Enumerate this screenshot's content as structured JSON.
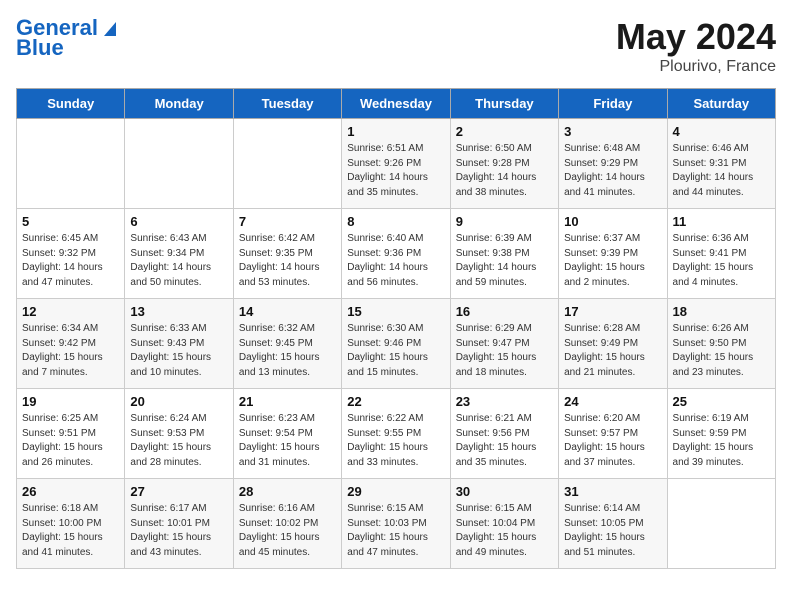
{
  "logo": {
    "line1": "General",
    "line2": "Blue"
  },
  "title": "May 2024",
  "location": "Plourivo, France",
  "days_header": [
    "Sunday",
    "Monday",
    "Tuesday",
    "Wednesday",
    "Thursday",
    "Friday",
    "Saturday"
  ],
  "weeks": [
    [
      {
        "num": "",
        "info": ""
      },
      {
        "num": "",
        "info": ""
      },
      {
        "num": "",
        "info": ""
      },
      {
        "num": "1",
        "info": "Sunrise: 6:51 AM\nSunset: 9:26 PM\nDaylight: 14 hours\nand 35 minutes."
      },
      {
        "num": "2",
        "info": "Sunrise: 6:50 AM\nSunset: 9:28 PM\nDaylight: 14 hours\nand 38 minutes."
      },
      {
        "num": "3",
        "info": "Sunrise: 6:48 AM\nSunset: 9:29 PM\nDaylight: 14 hours\nand 41 minutes."
      },
      {
        "num": "4",
        "info": "Sunrise: 6:46 AM\nSunset: 9:31 PM\nDaylight: 14 hours\nand 44 minutes."
      }
    ],
    [
      {
        "num": "5",
        "info": "Sunrise: 6:45 AM\nSunset: 9:32 PM\nDaylight: 14 hours\nand 47 minutes."
      },
      {
        "num": "6",
        "info": "Sunrise: 6:43 AM\nSunset: 9:34 PM\nDaylight: 14 hours\nand 50 minutes."
      },
      {
        "num": "7",
        "info": "Sunrise: 6:42 AM\nSunset: 9:35 PM\nDaylight: 14 hours\nand 53 minutes."
      },
      {
        "num": "8",
        "info": "Sunrise: 6:40 AM\nSunset: 9:36 PM\nDaylight: 14 hours\nand 56 minutes."
      },
      {
        "num": "9",
        "info": "Sunrise: 6:39 AM\nSunset: 9:38 PM\nDaylight: 14 hours\nand 59 minutes."
      },
      {
        "num": "10",
        "info": "Sunrise: 6:37 AM\nSunset: 9:39 PM\nDaylight: 15 hours\nand 2 minutes."
      },
      {
        "num": "11",
        "info": "Sunrise: 6:36 AM\nSunset: 9:41 PM\nDaylight: 15 hours\nand 4 minutes."
      }
    ],
    [
      {
        "num": "12",
        "info": "Sunrise: 6:34 AM\nSunset: 9:42 PM\nDaylight: 15 hours\nand 7 minutes."
      },
      {
        "num": "13",
        "info": "Sunrise: 6:33 AM\nSunset: 9:43 PM\nDaylight: 15 hours\nand 10 minutes."
      },
      {
        "num": "14",
        "info": "Sunrise: 6:32 AM\nSunset: 9:45 PM\nDaylight: 15 hours\nand 13 minutes."
      },
      {
        "num": "15",
        "info": "Sunrise: 6:30 AM\nSunset: 9:46 PM\nDaylight: 15 hours\nand 15 minutes."
      },
      {
        "num": "16",
        "info": "Sunrise: 6:29 AM\nSunset: 9:47 PM\nDaylight: 15 hours\nand 18 minutes."
      },
      {
        "num": "17",
        "info": "Sunrise: 6:28 AM\nSunset: 9:49 PM\nDaylight: 15 hours\nand 21 minutes."
      },
      {
        "num": "18",
        "info": "Sunrise: 6:26 AM\nSunset: 9:50 PM\nDaylight: 15 hours\nand 23 minutes."
      }
    ],
    [
      {
        "num": "19",
        "info": "Sunrise: 6:25 AM\nSunset: 9:51 PM\nDaylight: 15 hours\nand 26 minutes."
      },
      {
        "num": "20",
        "info": "Sunrise: 6:24 AM\nSunset: 9:53 PM\nDaylight: 15 hours\nand 28 minutes."
      },
      {
        "num": "21",
        "info": "Sunrise: 6:23 AM\nSunset: 9:54 PM\nDaylight: 15 hours\nand 31 minutes."
      },
      {
        "num": "22",
        "info": "Sunrise: 6:22 AM\nSunset: 9:55 PM\nDaylight: 15 hours\nand 33 minutes."
      },
      {
        "num": "23",
        "info": "Sunrise: 6:21 AM\nSunset: 9:56 PM\nDaylight: 15 hours\nand 35 minutes."
      },
      {
        "num": "24",
        "info": "Sunrise: 6:20 AM\nSunset: 9:57 PM\nDaylight: 15 hours\nand 37 minutes."
      },
      {
        "num": "25",
        "info": "Sunrise: 6:19 AM\nSunset: 9:59 PM\nDaylight: 15 hours\nand 39 minutes."
      }
    ],
    [
      {
        "num": "26",
        "info": "Sunrise: 6:18 AM\nSunset: 10:00 PM\nDaylight: 15 hours\nand 41 minutes."
      },
      {
        "num": "27",
        "info": "Sunrise: 6:17 AM\nSunset: 10:01 PM\nDaylight: 15 hours\nand 43 minutes."
      },
      {
        "num": "28",
        "info": "Sunrise: 6:16 AM\nSunset: 10:02 PM\nDaylight: 15 hours\nand 45 minutes."
      },
      {
        "num": "29",
        "info": "Sunrise: 6:15 AM\nSunset: 10:03 PM\nDaylight: 15 hours\nand 47 minutes."
      },
      {
        "num": "30",
        "info": "Sunrise: 6:15 AM\nSunset: 10:04 PM\nDaylight: 15 hours\nand 49 minutes."
      },
      {
        "num": "31",
        "info": "Sunrise: 6:14 AM\nSunset: 10:05 PM\nDaylight: 15 hours\nand 51 minutes."
      },
      {
        "num": "",
        "info": ""
      }
    ]
  ]
}
